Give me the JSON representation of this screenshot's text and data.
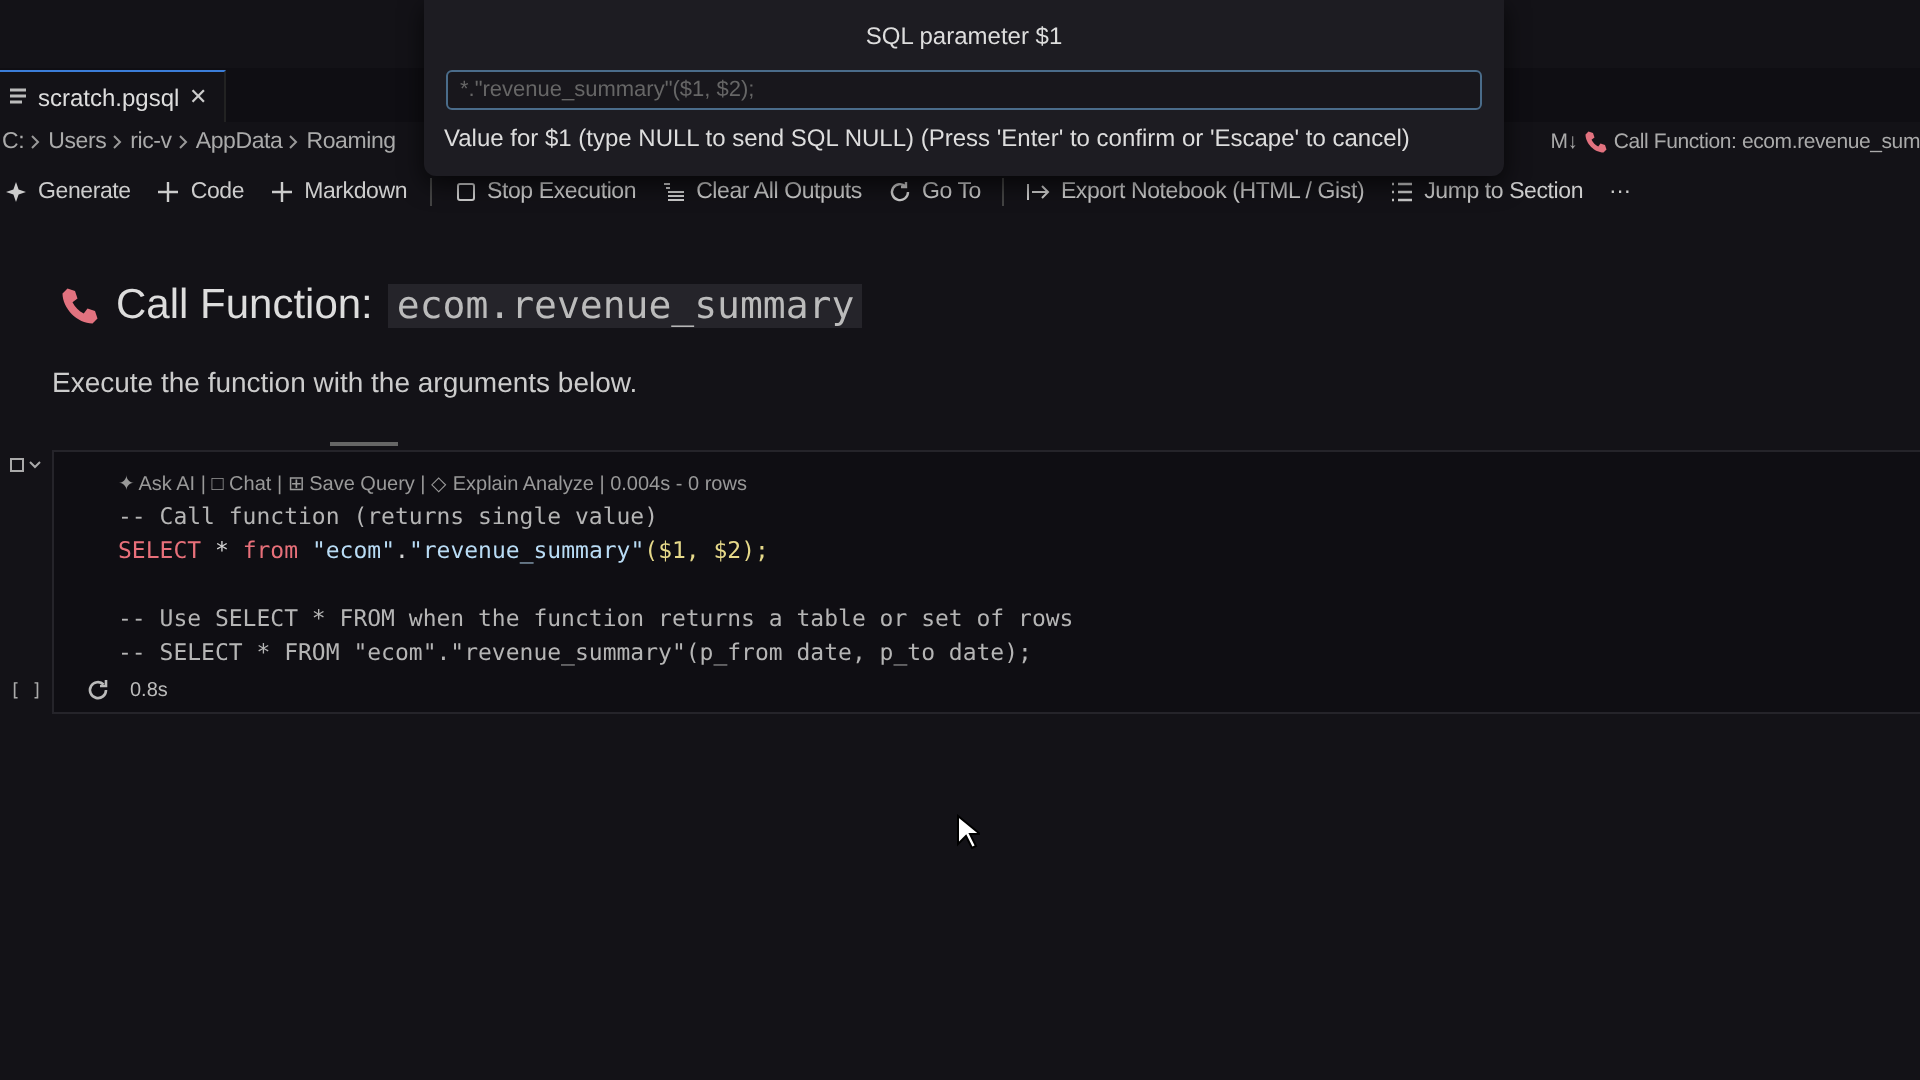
{
  "tab": {
    "label": "scratch.pgsql",
    "close": "✕",
    "selected": true
  },
  "breadcrumb": [
    "C:",
    "Users",
    "ric-v",
    "AppData",
    "Roaming"
  ],
  "breadcrumb_end": {
    "badge": "M↓",
    "label": "Call Function: ecom.revenue_sum"
  },
  "toolbar": [
    {
      "kind": "button",
      "label": "Generate"
    },
    {
      "kind": "button",
      "label": "Code"
    },
    {
      "kind": "button",
      "label": "Markdown"
    },
    {
      "kind": "divider"
    },
    {
      "kind": "button",
      "label": "Stop Execution"
    },
    {
      "kind": "button",
      "label": "Clear All Outputs"
    },
    {
      "kind": "button",
      "label": "Go To"
    },
    {
      "kind": "divider"
    },
    {
      "kind": "button",
      "label": "Export Notebook (HTML / Gist)"
    },
    {
      "kind": "button",
      "label": "Jump to Section"
    },
    {
      "kind": "more",
      "label": "···"
    }
  ],
  "markdown_cell": {
    "heading": "Call Function: ",
    "heading_code": "ecom.revenue_summary",
    "text": "Execute the function with the arguments below."
  },
  "code_cell": {
    "codelens": "✦ Ask AI | □ Chat | ⊞ Save Query | ◇ Explain Analyze | 0.004s - 0 rows",
    "blocks": [
      [
        [
          {
            "kind": "comment",
            "text": "-- Call function (returns single value)"
          }
        ],
        [
          {
            "kind": "keyword",
            "text": "SELECT"
          },
          {
            "kind": "plain",
            "text": " * "
          },
          {
            "kind": "keyword",
            "text": "from"
          },
          {
            "kind": "string",
            "text": " \"ecom\""
          },
          {
            "kind": "plain",
            "text": "."
          },
          {
            "kind": "string",
            "text": "\"revenue_summary\""
          },
          {
            "kind": "param",
            "text": "($1, $2);"
          }
        ]
      ],
      [
        [
          {
            "kind": "comment",
            "text": "-- Use SELECT * FROM when the function returns a table or set of rows"
          }
        ],
        [
          {
            "kind": "comment",
            "text": "-- SELECT * FROM \"ecom\".\"revenue_summary\"(p_from date, p_to date);"
          }
        ]
      ]
    ],
    "exec_count": "[ ]",
    "duration": "0.8s"
  },
  "prompt": {
    "title": "SQL parameter $1",
    "placeholder": "*.\"revenue_summary\"($1, $2);",
    "hint": "Value for $1 (type NULL to send SQL NULL) (Press 'Enter' to confirm or 'Escape' to cancel)"
  }
}
